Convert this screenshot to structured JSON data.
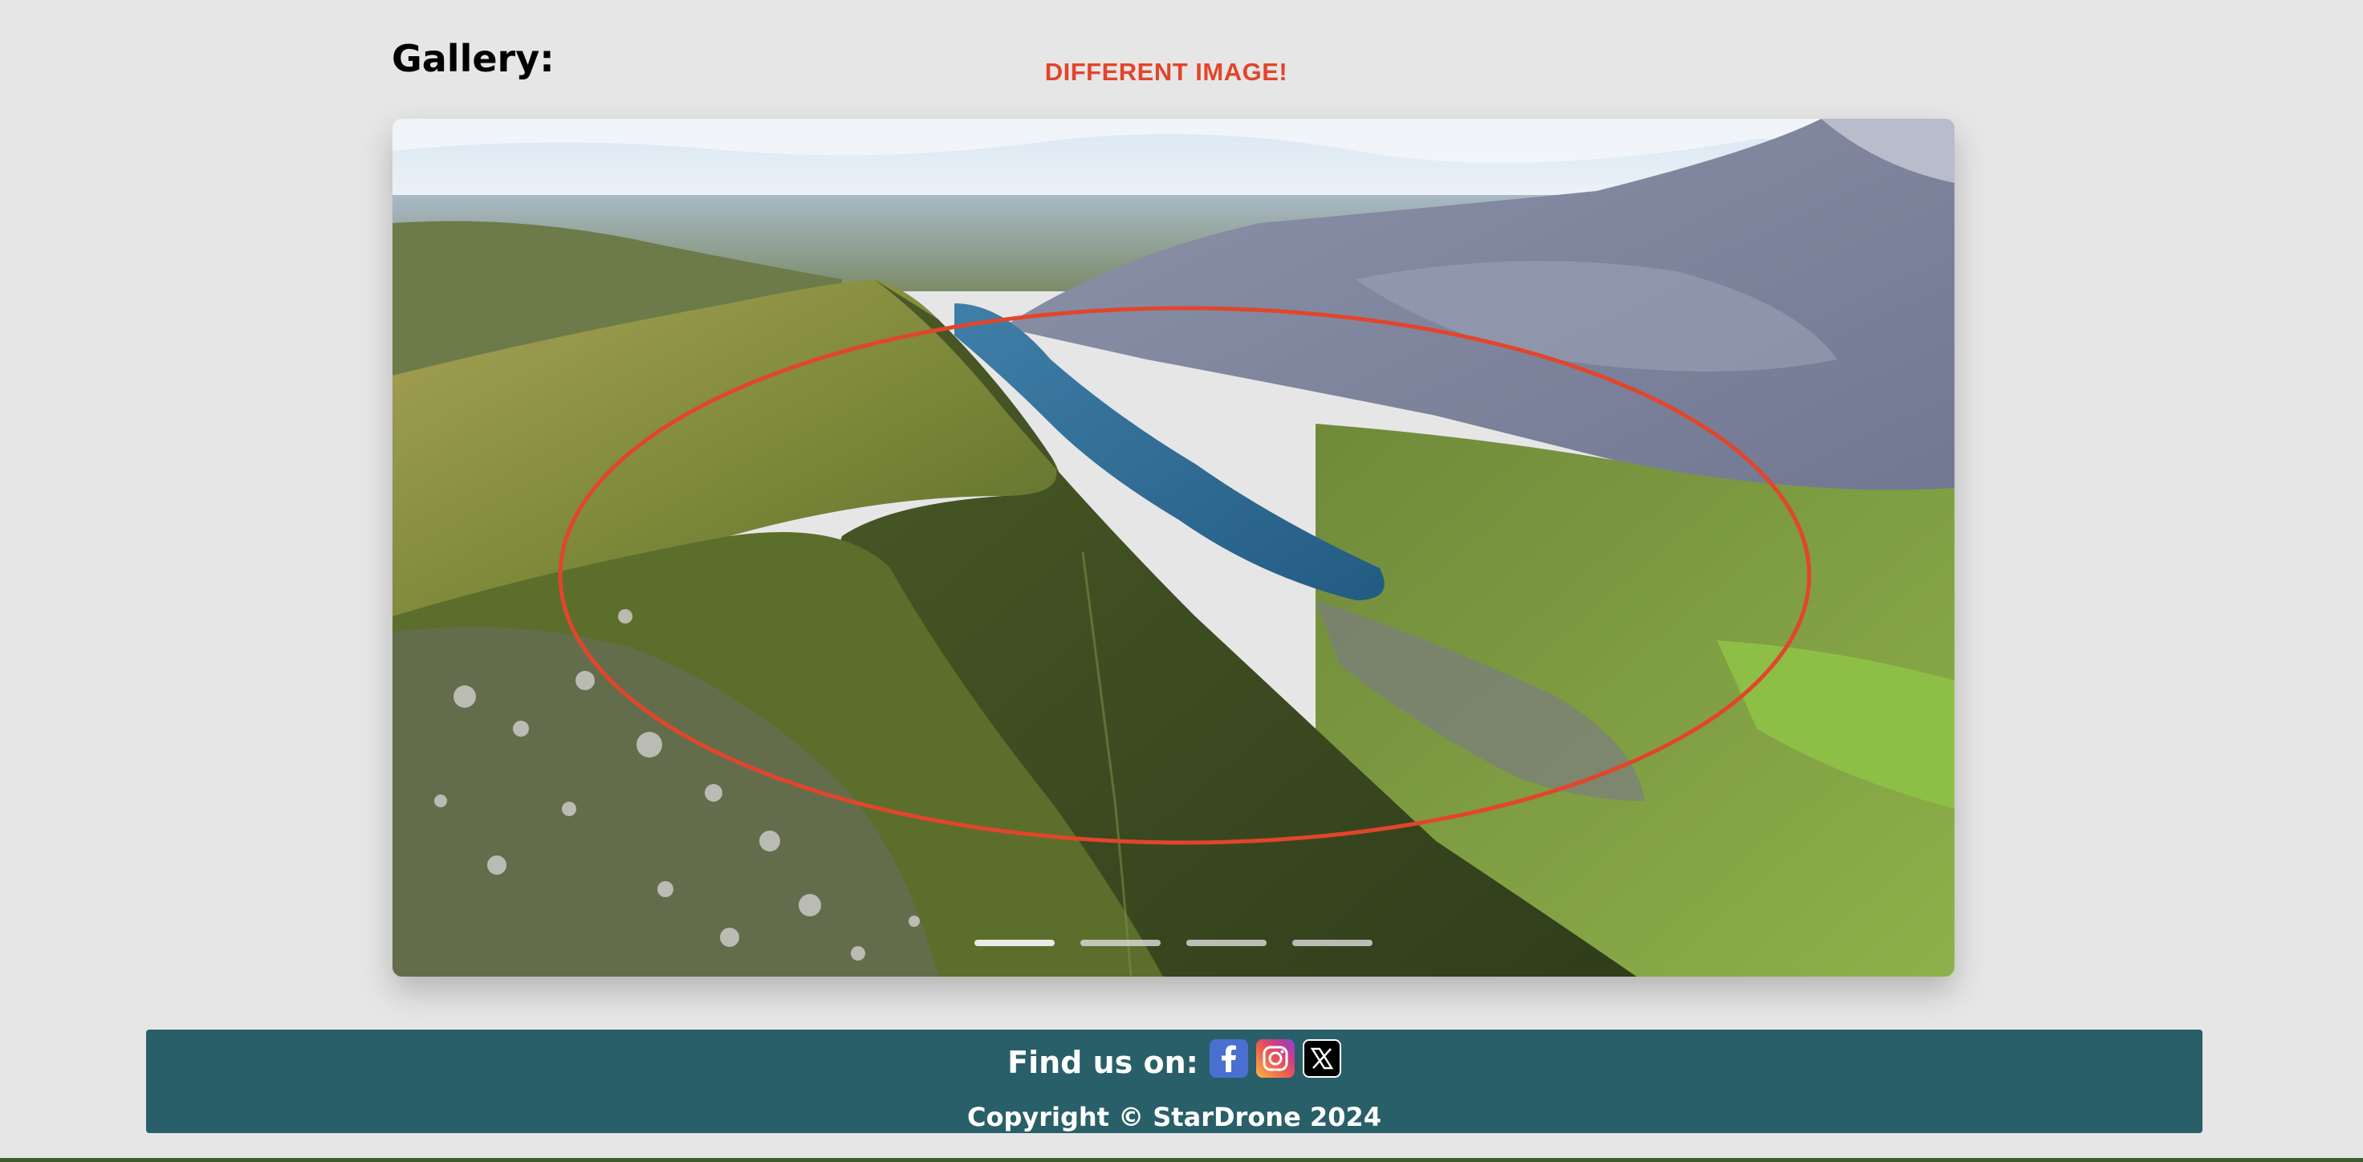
{
  "gallery": {
    "title": "Gallery:",
    "annotation_label": "DIFFERENT IMAGE!",
    "slide": {
      "description": "aerial view of a grassy mountain ridge beside a blue lake and slate quarry"
    },
    "indicators": [
      {
        "label": "slide 1",
        "active": true
      },
      {
        "label": "slide 2",
        "active": false
      },
      {
        "label": "slide 3",
        "active": false
      },
      {
        "label": "slide 4",
        "active": false
      }
    ]
  },
  "footer": {
    "find_label": "Find us on:",
    "socials": [
      {
        "name": "facebook-icon",
        "glyph": "f"
      },
      {
        "name": "instagram-icon",
        "glyph": "◎"
      },
      {
        "name": "x-icon",
        "glyph": "𝕏"
      }
    ],
    "copyright": "Copyright © StarDrone 2024"
  },
  "colors": {
    "background": "#e6e6e6",
    "footer": "#295f69",
    "annotation": "#e2452b"
  }
}
